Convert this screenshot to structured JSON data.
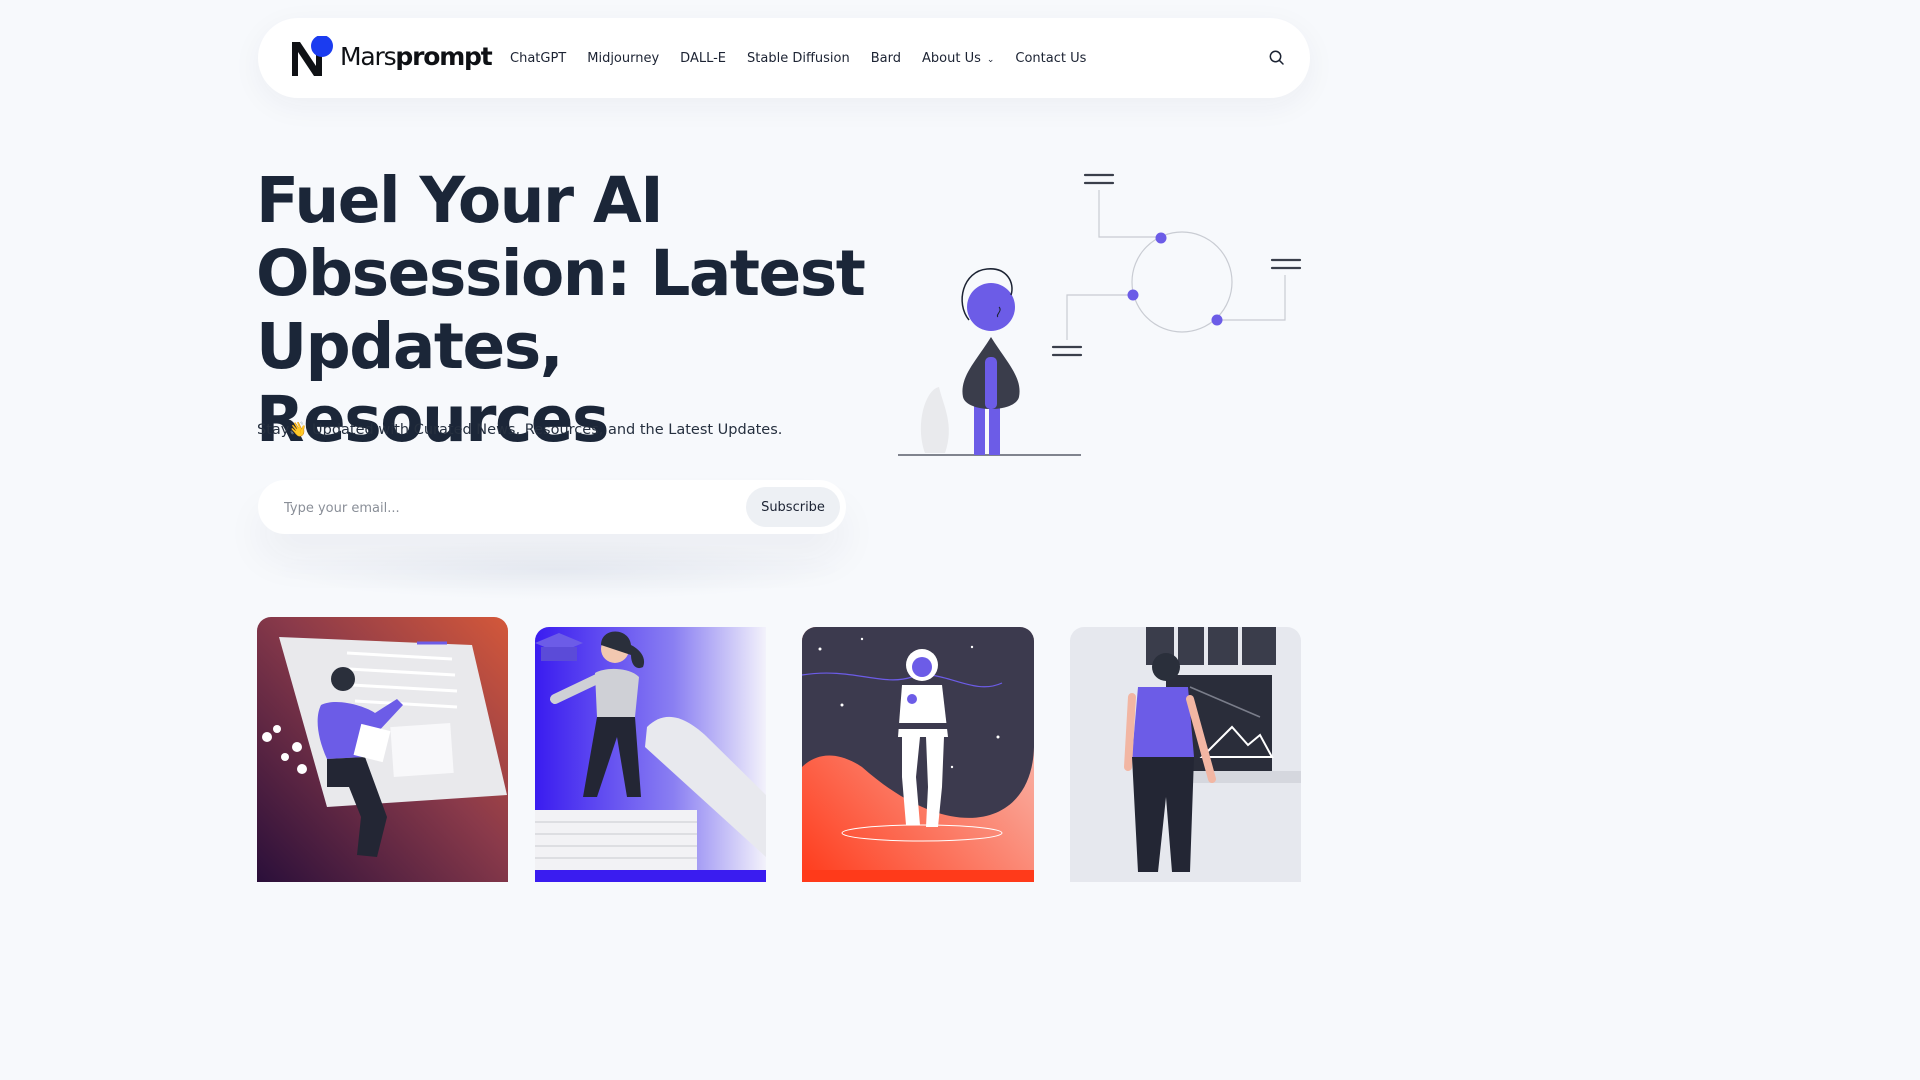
{
  "logo": {
    "text_light": "Mars",
    "text_bold": "prompt"
  },
  "nav": {
    "items": [
      "ChatGPT",
      "Midjourney",
      "DALL-E",
      "Stable Diffusion",
      "Bard",
      "About Us",
      "Contact Us"
    ],
    "about_has_dropdown": true
  },
  "icons": {
    "search": "search-icon",
    "chevron": "chevron-down-icon"
  },
  "hero": {
    "title_line1": "Fuel Your AI",
    "title_line2": "Obsession: Latest",
    "title_line3": "Updates, Resources",
    "subtitle": "Stay👋 Updated with Curated News, Resources, and the Latest Updates."
  },
  "subscribe": {
    "placeholder": "Type your email...",
    "button_label": "Subscribe"
  },
  "colors": {
    "accent": "#6c5ce7",
    "logo_dot": "#1b3cf0",
    "text_dark": "#1b2638",
    "background": "#f7f9fc"
  }
}
